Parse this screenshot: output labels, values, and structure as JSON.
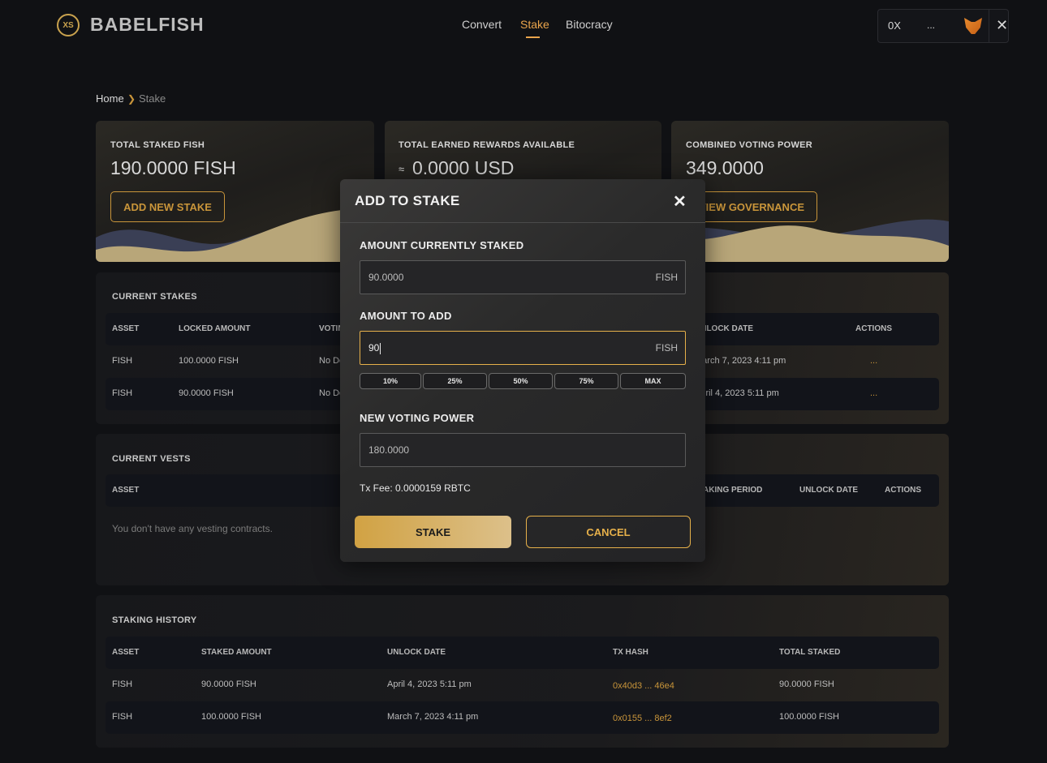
{
  "header": {
    "logo_mark": "XS",
    "logo_text": "BABELFISH",
    "nav": [
      "Convert",
      "Stake",
      "Bitocracy"
    ],
    "active_nav": "Stake",
    "wallet_address": "0X",
    "wallet_ellipsis": "...",
    "wallet_close": "✕"
  },
  "breadcrumb": {
    "home": "Home",
    "separator": "❯",
    "current": "Stake"
  },
  "cards": [
    {
      "label": "TOTAL STAKED FISH",
      "value": "190.0000 FISH",
      "button": "ADD NEW STAKE"
    },
    {
      "label": "TOTAL EARNED REWARDS AVAILABLE",
      "value_prefix": "≈",
      "value": "0.0000 USD"
    },
    {
      "label": "COMBINED VOTING POWER",
      "value": "349.0000",
      "button": "VIEW GOVERNANCE"
    }
  ],
  "current_stakes": {
    "title": "CURRENT STAKES",
    "columns": [
      "ASSET",
      "LOCKED AMOUNT",
      "VOTING POWER",
      "UNLOCK DATE",
      "ACTIONS"
    ],
    "rows": [
      {
        "asset": "FISH",
        "locked": "100.0000 FISH",
        "voting": "No Delegate",
        "unlock": "March 7, 2023 4:11 pm",
        "actions": "..."
      },
      {
        "asset": "FISH",
        "locked": "90.0000 FISH",
        "voting": "No Delegate",
        "unlock": "April 4, 2023 5:11 pm",
        "actions": "..."
      }
    ]
  },
  "current_vests": {
    "title": "CURRENT VESTS",
    "columns": [
      "ASSET",
      "STAKING PERIOD",
      "UNLOCK DATE",
      "ACTIONS"
    ],
    "empty": "You don't have any vesting contracts."
  },
  "staking_history": {
    "title": "STAKING HISTORY",
    "columns": [
      "ASSET",
      "STAKED AMOUNT",
      "UNLOCK DATE",
      "TX HASH",
      "TOTAL STAKED"
    ],
    "rows": [
      {
        "asset": "FISH",
        "staked": "90.0000 FISH",
        "unlock": "April 4, 2023 5:11 pm",
        "tx": "0x40d3 ... 46e4",
        "total": "90.0000 FISH"
      },
      {
        "asset": "FISH",
        "staked": "100.0000 FISH",
        "unlock": "March 7, 2023 4:11 pm",
        "tx": "0x0155 ... 8ef2",
        "total": "100.0000 FISH"
      }
    ]
  },
  "modal": {
    "title": "ADD TO STAKE",
    "close": "✕",
    "current_label": "AMOUNT CURRENTLY STAKED",
    "current_value": "90.0000",
    "unit": "FISH",
    "add_label": "AMOUNT TO ADD",
    "add_value": "90",
    "percent_buttons": [
      "10%",
      "25%",
      "50%",
      "75%",
      "MAX"
    ],
    "voting_label": "NEW VOTING POWER",
    "voting_value": "180.0000",
    "fee": "Tx Fee: 0.0000159 RBTC",
    "stake_button": "STAKE",
    "cancel_button": "CANCEL"
  },
  "colors": {
    "accent": "#e9a44c",
    "gold": "#c9953a",
    "background": "#101114"
  }
}
